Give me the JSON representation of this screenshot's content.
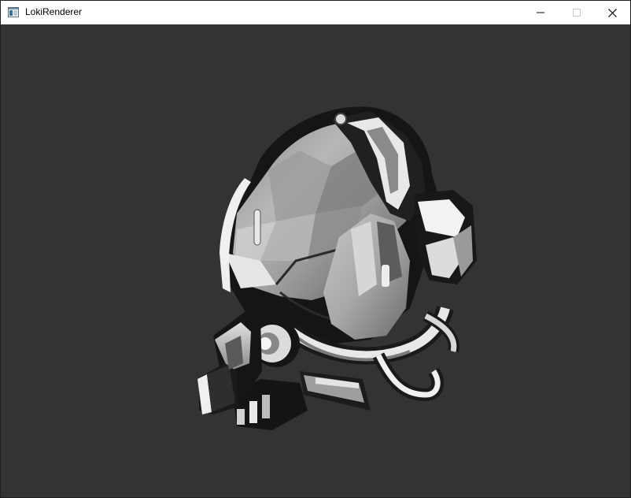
{
  "window": {
    "title": "LokiRenderer",
    "icon": "app-window-icon",
    "controls": {
      "minimize_icon": "minimize-icon",
      "maximize_icon": "maximize-icon",
      "close_icon": "close-icon"
    }
  },
  "viewport": {
    "background_color": "#333333",
    "content": "shaded-3d-helmet-model"
  }
}
